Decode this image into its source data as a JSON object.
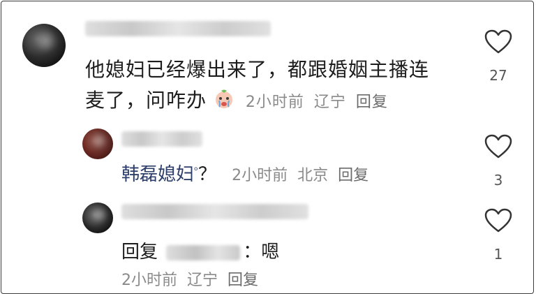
{
  "comments": [
    {
      "text_line1": "他媳妇已经爆出来了，都跟婚姻主播连",
      "text_line2": "麦了，问咋办",
      "time": "2小时前",
      "location": "辽宁",
      "reply_label": "回复",
      "likes": "27"
    },
    {
      "mention": "韩磊媳妇",
      "mention_suffix": "ᵒ",
      "rest": "？",
      "time": "2小时前",
      "location": "北京",
      "reply_label": "回复",
      "likes": "3"
    },
    {
      "prefix": "回复",
      "colon": "：",
      "body": "嗯",
      "time": "2小时前",
      "location": "辽宁",
      "reply_label": "回复",
      "likes": "1"
    }
  ]
}
